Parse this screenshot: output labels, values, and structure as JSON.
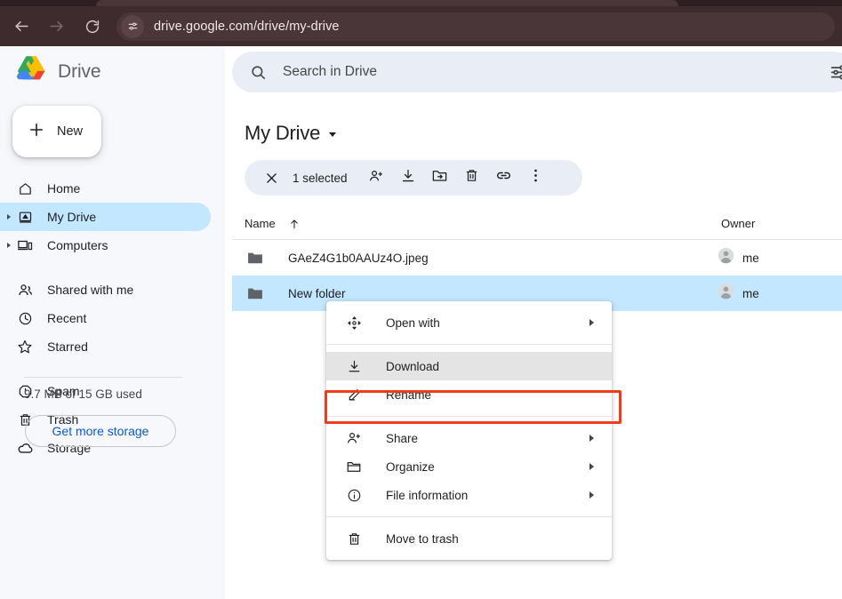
{
  "browser": {
    "url": "drive.google.com/drive/my-drive",
    "back_icon": "back-arrow-icon",
    "forward_icon": "forward-arrow-icon",
    "reload_icon": "reload-icon",
    "site_info_icon": "tune-icon"
  },
  "sidebar": {
    "brand": "Drive",
    "new_button": "New",
    "items": [
      {
        "label": "Home",
        "icon": "home-icon",
        "selected": false,
        "caret": false,
        "spaced": false
      },
      {
        "label": "My Drive",
        "icon": "my-drive-icon",
        "selected": true,
        "caret": true,
        "spaced": false
      },
      {
        "label": "Computers",
        "icon": "computers-icon",
        "selected": false,
        "caret": true,
        "spaced": false
      },
      {
        "label": "Shared with me",
        "icon": "people-icon",
        "selected": false,
        "caret": false,
        "spaced": true
      },
      {
        "label": "Recent",
        "icon": "clock-icon",
        "selected": false,
        "caret": false,
        "spaced": false
      },
      {
        "label": "Starred",
        "icon": "star-icon",
        "selected": false,
        "caret": false,
        "spaced": false
      },
      {
        "label": "Spam",
        "icon": "spam-icon",
        "selected": false,
        "caret": false,
        "spaced": true
      },
      {
        "label": "Trash",
        "icon": "trash-icon",
        "selected": false,
        "caret": false,
        "spaced": false
      },
      {
        "label": "Storage",
        "icon": "cloud-icon",
        "selected": false,
        "caret": false,
        "spaced": false
      }
    ],
    "storage_text": "9.7 MB of 15 GB used",
    "get_more_storage": "Get more storage"
  },
  "search": {
    "placeholder": "Search in Drive",
    "value": "",
    "search_icon": "search-icon",
    "tune_icon": "tune-icon"
  },
  "main": {
    "title": "My Drive",
    "toolbar": {
      "close_icon": "close-icon",
      "selected_count": "1 selected",
      "actions": [
        {
          "icon": "person-add-icon",
          "name": "share-button"
        },
        {
          "icon": "download-icon",
          "name": "download-button"
        },
        {
          "icon": "move-to-folder-icon",
          "name": "organize-button"
        },
        {
          "icon": "trash-icon",
          "name": "trash-button"
        },
        {
          "icon": "link-icon",
          "name": "get-link-button"
        },
        {
          "icon": "more-vert-icon",
          "name": "more-actions-button"
        }
      ]
    },
    "table": {
      "columns": {
        "name": "Name",
        "owner": "Owner"
      },
      "sort_icon": "sort-ascending-arrow-icon",
      "rows": [
        {
          "name": "GAeZ4G1b0AAUz4O.jpeg",
          "owner": "me",
          "icon": "folder-icon",
          "selected": false
        },
        {
          "name": "New folder",
          "owner": "me",
          "icon": "folder-icon",
          "selected": true
        }
      ]
    }
  },
  "context_menu": {
    "groups": [
      [
        {
          "label": "Open with",
          "icon": "open-with-icon",
          "arrow": true,
          "highlighted": false
        }
      ],
      [
        {
          "label": "Download",
          "icon": "download-icon",
          "arrow": false,
          "highlighted": true
        },
        {
          "label": "Rename",
          "icon": "pencil-icon",
          "arrow": false,
          "highlighted": false
        }
      ],
      [
        {
          "label": "Share",
          "icon": "person-add-icon",
          "arrow": true,
          "highlighted": false
        },
        {
          "label": "Organize",
          "icon": "folder-open-icon",
          "arrow": true,
          "highlighted": false
        },
        {
          "label": "File information",
          "icon": "info-icon",
          "arrow": true,
          "highlighted": false
        }
      ],
      [
        {
          "label": "Move to trash",
          "icon": "trash-icon",
          "arrow": false,
          "highlighted": false
        }
      ]
    ]
  },
  "annotation": {
    "highlight_color": "#f03b1d",
    "target": "Download"
  },
  "colors": {
    "chrome_bg": "#3d2b2e",
    "sidebar_bg": "#f7f8fb",
    "selection_blue": "#c2e7ff",
    "search_bg": "#e9eef6",
    "link_blue": "#0b57d0"
  }
}
